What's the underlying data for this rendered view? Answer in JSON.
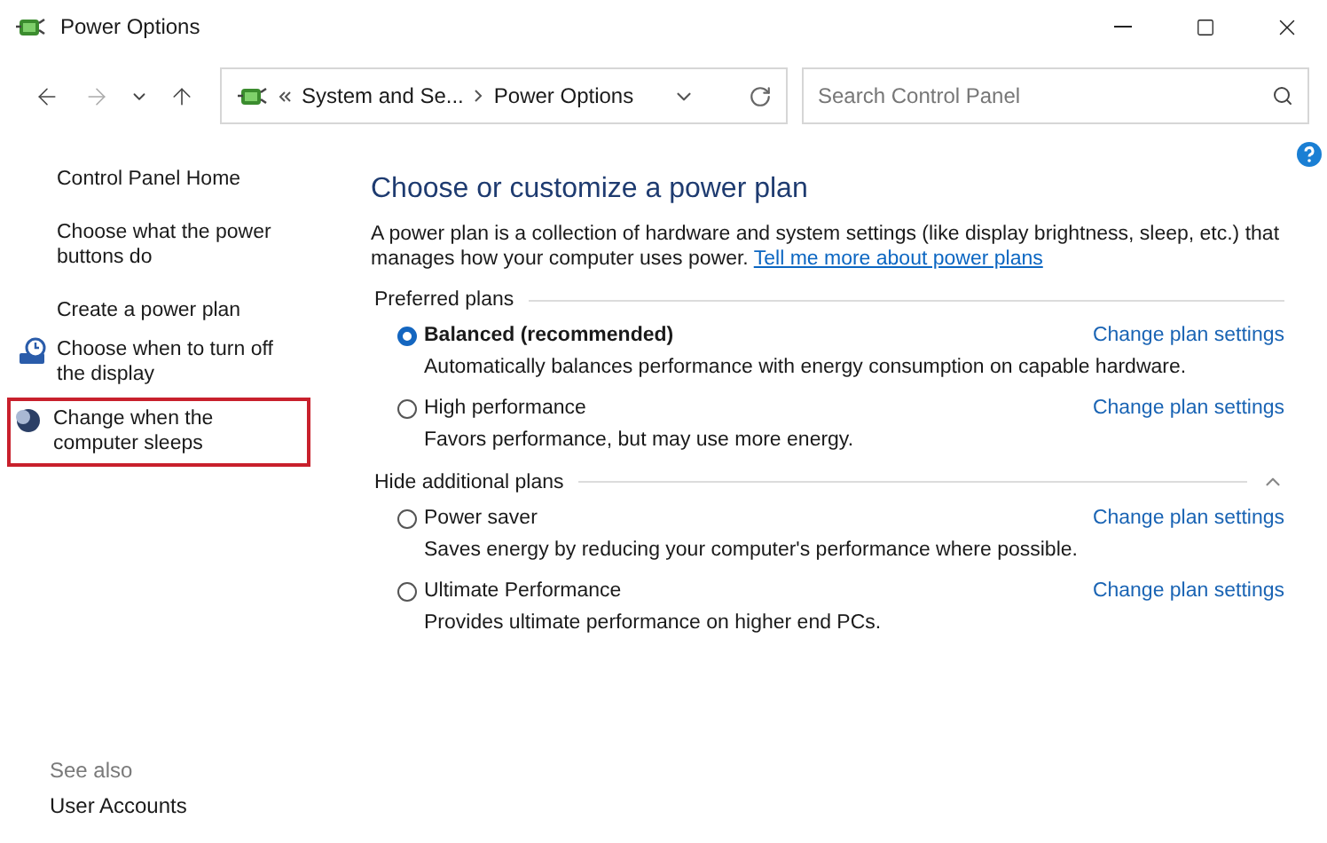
{
  "window": {
    "title": "Power Options"
  },
  "address": {
    "crumbs": [
      "System and Se...",
      "Power Options"
    ]
  },
  "search": {
    "placeholder": "Search Control Panel"
  },
  "sidebar": {
    "items": [
      {
        "label": "Control Panel Home",
        "highlighted": false
      },
      {
        "label": "Choose what the power buttons do",
        "highlighted": false
      },
      {
        "label": "Create a power plan",
        "highlighted": false
      },
      {
        "label": "Choose when to turn off the display",
        "highlighted": false
      },
      {
        "label": "Change when the computer sleeps",
        "highlighted": true
      }
    ],
    "see_also": {
      "heading": "See also",
      "links": [
        "User Accounts"
      ]
    }
  },
  "main": {
    "heading": "Choose or customize a power plan",
    "intro": "A power plan is a collection of hardware and system settings (like display brightness, sleep, etc.) that manages how your computer uses power.",
    "intro_link": "Tell me more about power plans",
    "sections": [
      {
        "heading": "Preferred plans",
        "plans": [
          {
            "name": "Balanced (recommended)",
            "description": "Automatically balances performance with energy consumption on capable hardware.",
            "selected": true,
            "link": "Change plan settings"
          },
          {
            "name": "High performance",
            "description": "Favors performance, but may use more energy.",
            "selected": false,
            "link": "Change plan settings"
          }
        ]
      },
      {
        "heading": "Hide additional plans",
        "plans": [
          {
            "name": "Power saver",
            "description": "Saves energy by reducing your computer's performance where possible.",
            "selected": false,
            "link": "Change plan settings"
          },
          {
            "name": "Ultimate Performance",
            "description": "Provides ultimate performance on higher end PCs.",
            "selected": false,
            "link": "Change plan settings"
          }
        ]
      }
    ]
  }
}
